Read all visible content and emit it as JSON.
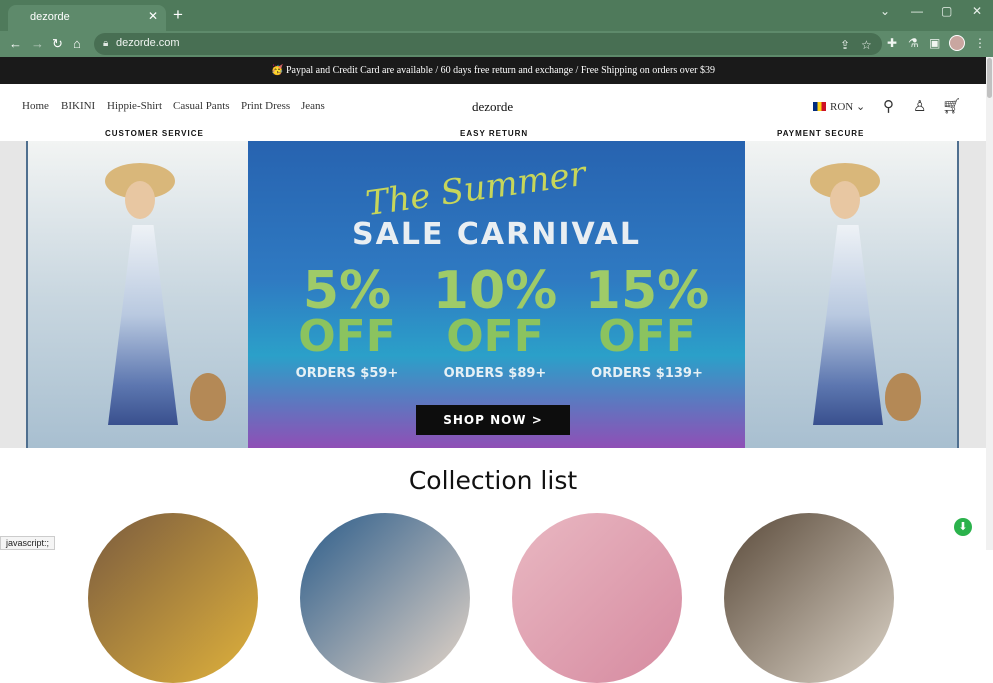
{
  "browser": {
    "tab_title": "dezorde",
    "url": "dezorde.com",
    "new_tab_glyph": "+",
    "close_glyph": "✕",
    "window_controls": {
      "dropdown": "⌄",
      "minimize": "—",
      "maximize": "▢",
      "close": "✕"
    },
    "toolbar_icons": [
      "share-icon",
      "star-icon",
      "extensions-icon",
      "labs-icon",
      "side-panel-icon",
      "profile-avatar",
      "menu-icon"
    ]
  },
  "announcement": "🥳 Paypal and Credit Card are available / 60 days free return and exchange / Free Shipping on orders over $39",
  "header": {
    "nav": [
      "Home",
      "BIKINI",
      "Hippie-Shirt",
      "Casual Pants",
      "Print Dress",
      "Jeans"
    ],
    "logo": "dezorde",
    "currency": "RON",
    "icons": [
      "search-icon",
      "account-icon",
      "cart-icon"
    ]
  },
  "service_strip": [
    "CUSTOMER SERVICE",
    "EASY RETURN",
    "PAYMENT SECURE"
  ],
  "hero": {
    "script_title": "The Summer",
    "headline": "SALE CARNIVAL",
    "offers": [
      {
        "percent": "5%",
        "off": "OFF",
        "orders": "ORDERS $59+"
      },
      {
        "percent": "10%",
        "off": "OFF",
        "orders": "ORDERS $89+"
      },
      {
        "percent": "15%",
        "off": "OFF",
        "orders": "ORDERS $139+"
      }
    ],
    "cta": "SHOP NOW >",
    "colors": {
      "offer_green": "#9fcb68",
      "script_green": "#c7d65a",
      "background_blue": "#2763b0"
    }
  },
  "collection": {
    "title": "Collection list"
  },
  "status_bar": "javascript:;",
  "colors": {
    "browser_frame": "#4f7a5b",
    "announcement_bg": "#1a1a1a",
    "chat_green": "#2bb24c"
  }
}
